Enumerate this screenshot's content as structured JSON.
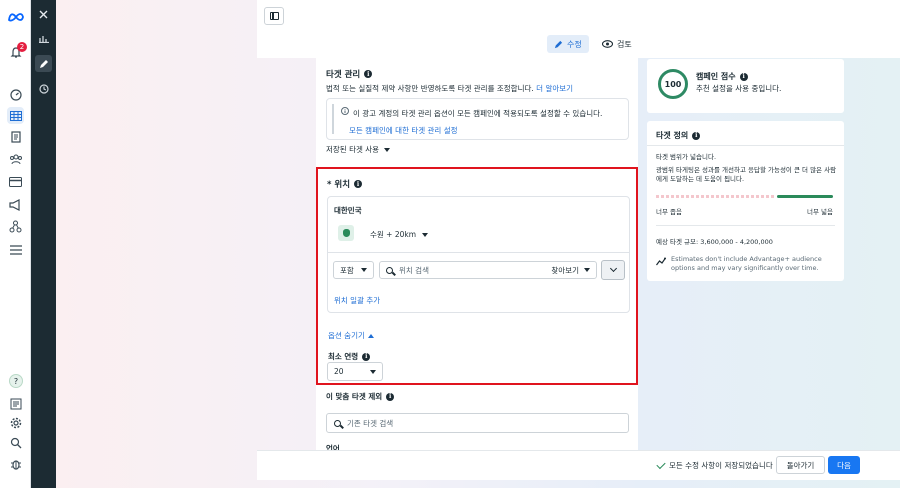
{
  "nav": {
    "notification_count": "2"
  },
  "topbar": {
    "edit_label": "수정",
    "review_label": "검토"
  },
  "targeting": {
    "title": "타겟 관리",
    "description": "법적 또는 실질적 제약 사항만 반영하도록 타겟 관리를 조정합니다.",
    "learn_more": "더 알아보기",
    "notice_text": "이 광고 계정의 타겟 관리 옵션이 모든 캠페인에 적용되도록 설정할 수 있습니다.",
    "notice_link": "모든 캠페인에 대한 타겟 관리 설정",
    "saved_audience": "저장된 타겟 사용"
  },
  "location": {
    "title": "* 위치",
    "country": "대한민국",
    "city": "수원 + 20km",
    "include_label": "포함",
    "search_placeholder": "위치 검색",
    "browse_label": "찾아보기",
    "bulk_add": "위치 일괄 추가",
    "hide_options": "옵션 숨기기",
    "min_age_title": "최소 연령",
    "min_age_value": "20"
  },
  "exclude": {
    "title": "이 맞춤 타겟 제외",
    "search_placeholder": "기존 타겟 검색",
    "language_title": "언어"
  },
  "score": {
    "value": "100",
    "title": "캠페인 점수",
    "subtitle": "추천 설정을 사용 중입니다."
  },
  "definition": {
    "title": "타겟 정의",
    "breadth": "타겟 범위가 넓습니다.",
    "body": "광범위 타게팅은 성과를 개선하고 응답할 가능성이 큰 더 많은 사람에게 도달하는 데 도움이 됩니다.",
    "narrow_label": "너무 좁음",
    "broad_label": "너무 넓음",
    "estimate": "예상 타겟 규모: 3,600,000 - 4,200,000",
    "advantage_note": "Estimates don't include Advantage+ audience options and may vary significantly over time."
  },
  "bottombar": {
    "saved_message": "모든 수정 사항이 저장되었습니다",
    "back_label": "돌아가기",
    "next_label": "다음"
  },
  "colors": {
    "accent": "#1877f2",
    "highlight_border": "#e0141e",
    "score_green": "#2e8a64"
  }
}
